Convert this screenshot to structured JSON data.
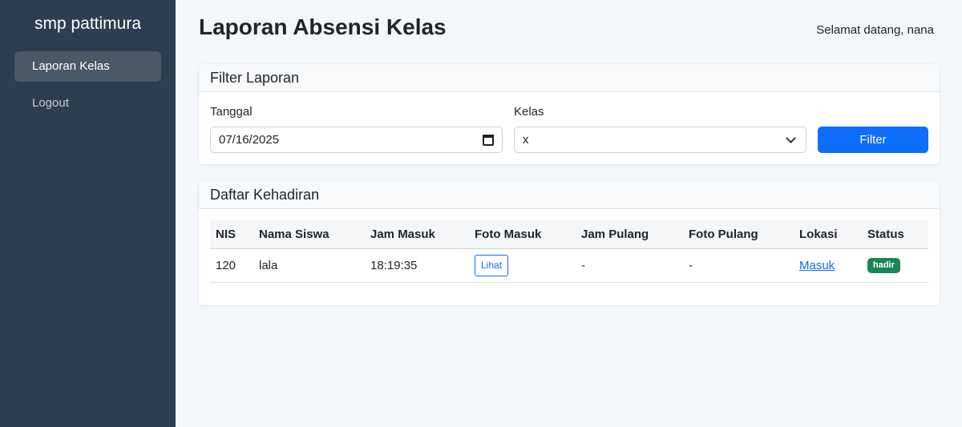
{
  "sidebar": {
    "brand": "smp pattimura",
    "items": [
      {
        "label": "Laporan Kelas"
      },
      {
        "label": "Logout"
      }
    ]
  },
  "header": {
    "title": "Laporan Absensi Kelas",
    "welcome": "Selamat datang, nana"
  },
  "filter": {
    "title": "Filter Laporan",
    "date_label": "Tanggal",
    "date_value": "07/16/2025",
    "class_label": "Kelas",
    "class_value": "x",
    "button": "Filter"
  },
  "attendance": {
    "title": "Daftar Kehadiran",
    "columns": [
      "NIS",
      "Nama Siswa",
      "Jam Masuk",
      "Foto Masuk",
      "Jam Pulang",
      "Foto Pulang",
      "Lokasi",
      "Status"
    ],
    "rows": [
      {
        "nis": "120",
        "nama": "lala",
        "jam_masuk": "18:19:35",
        "foto_masuk": "Lihat",
        "jam_pulang": "-",
        "foto_pulang": "-",
        "lokasi": "Masuk",
        "status": "hadir"
      }
    ]
  },
  "colors": {
    "sidebar_bg": "#2c3e50",
    "primary": "#0d6efd",
    "success": "#198754"
  }
}
